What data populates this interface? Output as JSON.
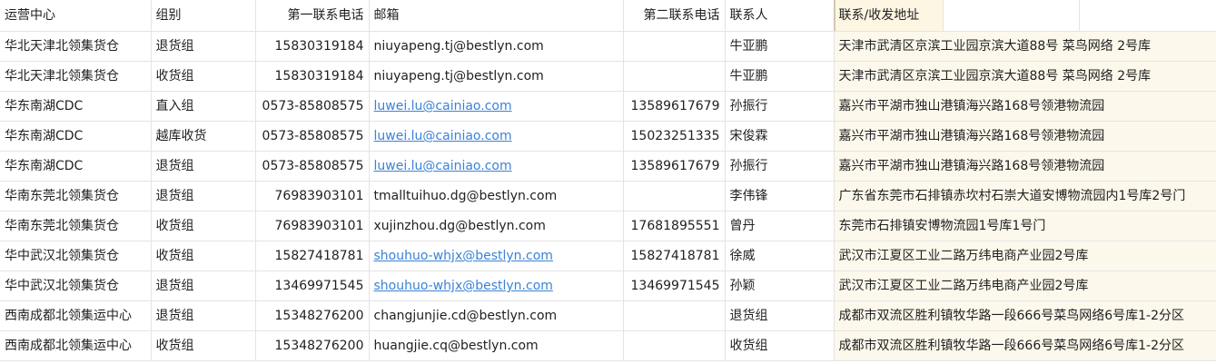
{
  "headers": [
    "运营中心",
    "组别",
    "第一联系电话",
    "邮箱",
    "第二联系电话",
    "联系人",
    "联系/收发地址",
    "",
    ""
  ],
  "rows": [
    {
      "center": "华北天津北领集货仓",
      "group": "退货组",
      "phone1": "15830319184",
      "email": "niuyapeng.tj@bestlyn.com",
      "email_link": false,
      "phone2": "",
      "contact": "牛亚鹏",
      "address": "天津市武清区京滨工业园京滨大道88号 菜鸟网络 2号库"
    },
    {
      "center": "华北天津北领集货仓",
      "group": "收货组",
      "phone1": "15830319184",
      "email": "niuyapeng.tj@bestlyn.com",
      "email_link": false,
      "phone2": "",
      "contact": "牛亚鹏",
      "address": "天津市武清区京滨工业园京滨大道88号 菜鸟网络 2号库"
    },
    {
      "center": "华东南湖CDC",
      "group": "直入组",
      "phone1": "0573-85808575",
      "email": "luwei.lu@cainiao.com",
      "email_link": true,
      "phone2": "13589617679",
      "contact": "孙振行",
      "address": "嘉兴市平湖市独山港镇海兴路168号领港物流园"
    },
    {
      "center": "华东南湖CDC",
      "group": "越库收货",
      "phone1": "0573-85808575",
      "email": "luwei.lu@cainiao.com",
      "email_link": true,
      "phone2": "15023251335",
      "contact": "宋俊霖",
      "address": "嘉兴市平湖市独山港镇海兴路168号领港物流园"
    },
    {
      "center": "华东南湖CDC",
      "group": "退货组",
      "phone1": "0573-85808575",
      "email": "luwei.lu@cainiao.com",
      "email_link": true,
      "phone2": "13589617679",
      "contact": "孙振行",
      "address": "嘉兴市平湖市独山港镇海兴路168号领港物流园"
    },
    {
      "center": "华南东莞北领集货仓",
      "group": "退货组",
      "phone1": "76983903101",
      "email": "tmalltuihuo.dg@bestlyn.com",
      "email_link": false,
      "phone2": "",
      "contact": "李伟锋",
      "address": "广东省东莞市石排镇赤坎村石崇大道安博物流园内1号库2号门"
    },
    {
      "center": "华南东莞北领集货仓",
      "group": "收货组",
      "phone1": "76983903101",
      "email": "xujinzhou.dg@bestlyn.com",
      "email_link": false,
      "phone2": "17681895551",
      "contact": "曾丹",
      "address": "东莞市石排镇安博物流园1号库1号门"
    },
    {
      "center": "华中武汉北领集货仓",
      "group": "收货组",
      "phone1": "15827418781",
      "email": "shouhuo-whjx@bestlyn.com",
      "email_link": true,
      "phone2": "15827418781",
      "contact": "徐威",
      "address": "武汉市江夏区工业二路万纬电商产业园2号库"
    },
    {
      "center": "华中武汉北领集货仓",
      "group": "退货组",
      "phone1": "13469971545",
      "email": "shouhuo-whjx@bestlyn.com",
      "email_link": true,
      "phone2": "13469971545",
      "contact": "孙颖",
      "address": "武汉市江夏区工业二路万纬电商产业园2号库"
    },
    {
      "center": "西南成都北领集运中心",
      "group": "退货组",
      "phone1": "15348276200",
      "email": "changjunjie.cd@bestlyn.com",
      "email_link": false,
      "phone2": "",
      "contact": "退货组",
      "address": "成都市双流区胜利镇牧华路一段666号菜鸟网络6号库1-2分区"
    },
    {
      "center": "西南成都北领集运中心",
      "group": "收货组",
      "phone1": "15348276200",
      "email": "huangjie.cq@bestlyn.com",
      "email_link": false,
      "phone2": "",
      "contact": "收货组",
      "address": "成都市双流区胜利镇牧华路一段666号菜鸟网络6号库1-2分区"
    }
  ]
}
